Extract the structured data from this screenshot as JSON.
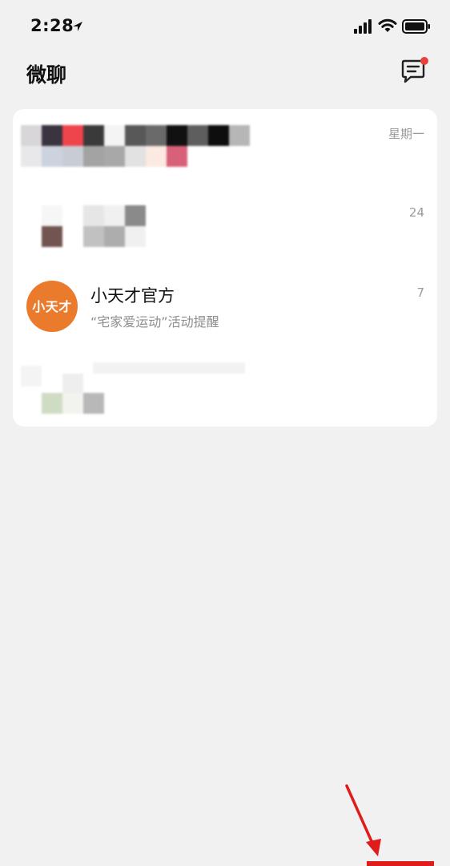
{
  "status_bar": {
    "time": "2:28",
    "location_icon": "location-arrow-icon",
    "signal_icon": "cellular-signal-icon",
    "wifi_icon": "wifi-icon",
    "battery_icon": "battery-icon"
  },
  "header": {
    "title": "微聊",
    "compose_icon": "message-compose-icon",
    "has_notification_dot": true
  },
  "chats": [
    {
      "name": "",
      "preview": "",
      "time": "星期一",
      "avatar": "pixelated"
    },
    {
      "name": "",
      "preview": "",
      "time": "24",
      "avatar": "pixelated"
    },
    {
      "name": "小天才官方",
      "preview": "“宅家爱运动”活动提醒",
      "time": "7",
      "avatar_text": "小天才"
    },
    {
      "name": "",
      "preview": "",
      "time": "",
      "avatar": "pixelated"
    }
  ],
  "annotation": {
    "arrow_color": "#e01b1b"
  },
  "colors": {
    "accent_orange": "#ea7b2c",
    "notification_red": "#e8413a",
    "background": "#f1f1f1"
  }
}
